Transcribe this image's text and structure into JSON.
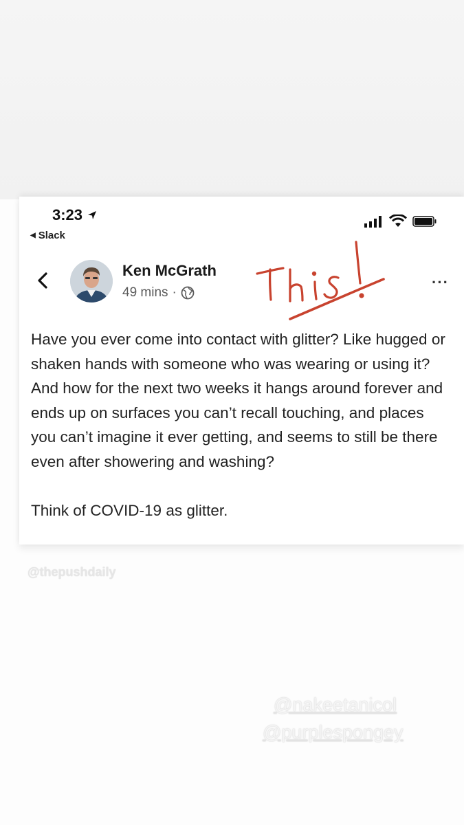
{
  "status_bar": {
    "time": "3:23",
    "back_app": "Slack"
  },
  "post": {
    "author": "Ken McGrath",
    "time_ago": "49 mins",
    "separator": "·",
    "more_label": "···",
    "annotation": "This!",
    "paragraphs": [
      "Have you ever come into contact with glitter? Like hugged or shaken hands with someone who was wearing or using it? And how for the next two weeks it hangs around forever and ends up on surfaces you can’t recall touching, and places you can’t imagine it ever getting, and seems to still be there even after showering and washing?",
      "Think of COVID-19 as glitter."
    ]
  },
  "watermarks": {
    "source": "@thepushdaily",
    "handle_1": "@nakeetanicol",
    "handle_2": "@purplespongey"
  },
  "colors": {
    "annotation_ink": "#c8432f",
    "text": "#222222",
    "meta": "#5b5b5b"
  },
  "icons": [
    "location-arrow-icon",
    "back-triangle-icon",
    "signal-icon",
    "wifi-icon",
    "battery-icon",
    "chevron-left-icon",
    "globe-icon",
    "more-icon"
  ]
}
